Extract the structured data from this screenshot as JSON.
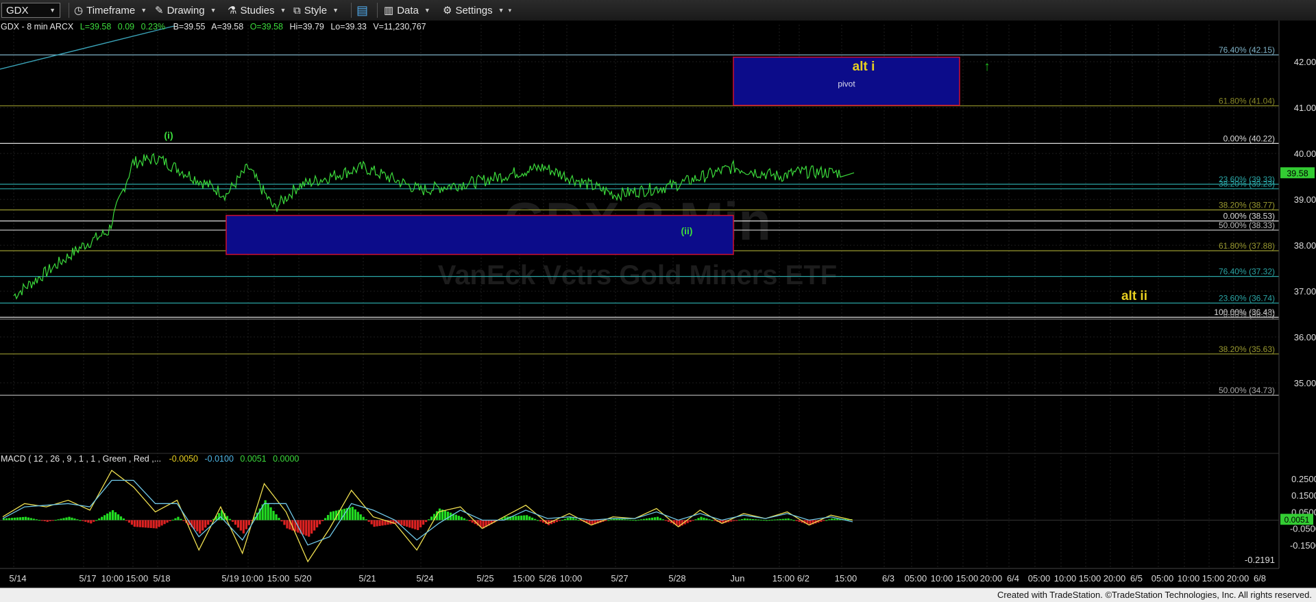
{
  "toolbar": {
    "symbol": "GDX",
    "timeframe": "Timeframe",
    "drawing": "Drawing",
    "studies": "Studies",
    "style": "Style",
    "data": "Data",
    "settings": "Settings"
  },
  "header_quote": {
    "label": "GDX - 8 min  ARCX",
    "last": "L=39.58",
    "change": "0.09",
    "change_pct": "0.23%",
    "bid": "B=39.55",
    "ask": "A=39.58",
    "open": "O=39.58",
    "high": "Hi=39.79",
    "low": "Lo=39.33",
    "volume": "V=11,230,767"
  },
  "watermark": {
    "line1": "GDX 8 Min",
    "line2": "VanEck Vctrs Gold Miners ETF"
  },
  "colors": {
    "price_line": "#3cdc3c",
    "box_fill": "#0c0c8a",
    "box_border": "#d01030",
    "label_yellow": "#e8d020",
    "macd_yellow": "#f0e050",
    "macd_cyan": "#70c8e8"
  },
  "chart_data": [
    {
      "type": "line",
      "series": [
        {
          "name": "GDX - 8 min",
          "x": [
            "5/14",
            "5/17",
            "5/17 10:00",
            "5/17 15:00",
            "5/18",
            "5/19",
            "5/19 10:00",
            "5/19 15:00",
            "5/20",
            "5/21",
            "5/24",
            "5/25",
            "5/25 15:00",
            "5/26",
            "5/26 10:00",
            "5/27",
            "5/28",
            "Jun",
            "Jun 15:00",
            "6/2",
            "6/2 15:00"
          ],
          "values": [
            36.9,
            38.0,
            38.3,
            39.8,
            39.9,
            39.1,
            39.7,
            38.8,
            39.3,
            39.7,
            39.2,
            39.4,
            39.6,
            39.7,
            39.5,
            39.1,
            39.3,
            39.7,
            39.5,
            39.6,
            39.58
          ]
        }
      ],
      "last_price": 39.58,
      "ylim": [
        34.0,
        42.6
      ],
      "y_ticks": [
        "42.00",
        "41.00",
        "40.00",
        "39.00",
        "38.00",
        "37.00",
        "36.00",
        "35.00"
      ],
      "x_ticks": [
        "5/14",
        "5/17",
        "10:00",
        "15:00",
        "5/18",
        "5/19",
        "10:00",
        "15:00",
        "5/20",
        "5/21",
        "5/24",
        "5/25",
        "15:00",
        "5/26",
        "10:00",
        "5/27",
        "5/28",
        "Jun",
        "15:00",
        "6/2",
        "15:00",
        "6/3",
        "05:00",
        "10:00",
        "15:00",
        "20:00",
        "6/4",
        "05:00",
        "10:00",
        "15:00",
        "20:00",
        "6/5",
        "05:00",
        "10:00",
        "15:00",
        "20:00",
        "6/8"
      ],
      "fib_levels": [
        {
          "label": "76.40% (42.15)",
          "value": 42.15,
          "color": "#7fb3c8"
        },
        {
          "label": "61.80% (41.04)",
          "value": 41.04,
          "color": "#8a8a28"
        },
        {
          "label": "0.00% (40.22)",
          "value": 40.22,
          "color": "#dddddd"
        },
        {
          "label": "23.60% (39.33)",
          "value": 39.33,
          "color": "#2aa5a5"
        },
        {
          "label": "38.20% (39.23)",
          "value": 39.23,
          "color": "#2aa5a5"
        },
        {
          "label": "38.20% (38.77)",
          "value": 38.77,
          "color": "#9a9a30"
        },
        {
          "label": "0.00% (38.53)",
          "value": 38.53,
          "color": "#dddddd"
        },
        {
          "label": "50.00% (38.33)",
          "value": 38.33,
          "color": "#bbbbbb"
        },
        {
          "label": "61.80% (37.88)",
          "value": 37.88,
          "color": "#9a9a30"
        },
        {
          "label": "76.40% (37.32)",
          "value": 37.32,
          "color": "#2aa5a5"
        },
        {
          "label": "23.60% (36.74)",
          "value": 36.74,
          "color": "#2aa5a5"
        },
        {
          "label": "100.00% (36.43)",
          "value": 36.43,
          "color": "#dddddd"
        },
        {
          "label": "0.00% (36.39)",
          "value": 36.39,
          "color": "#888888"
        },
        {
          "label": "38.20% (35.63)",
          "value": 35.63,
          "color": "#9a9a30"
        },
        {
          "label": "50.00% (34.73)",
          "value": 34.73,
          "color": "#aaaaaa"
        }
      ],
      "zones": [
        {
          "name": "alt i",
          "sublabel": "pivot",
          "y_top": 42.1,
          "y_bottom": 41.05,
          "x_start": "Jun",
          "x_end": "6/3"
        },
        {
          "name": "",
          "sublabel": "",
          "y_top": 38.65,
          "y_bottom": 37.8,
          "x_start": "5/19",
          "x_end": "Jun"
        }
      ],
      "annotations": [
        {
          "text": "(i)",
          "x": "5/18",
          "y": 40.38,
          "color": "#3cdc3c"
        },
        {
          "text": "(ii)",
          "x": "5/28",
          "y": 38.3,
          "color": "#3cdc3c"
        },
        {
          "text": "alt i",
          "x": "Jun",
          "y": 41.9,
          "color": "#e8d020"
        },
        {
          "text": "alt ii",
          "x": "6/4",
          "y": 36.9,
          "color": "#e8d020"
        },
        {
          "text": "↑",
          "x": "6/3",
          "y": 41.9,
          "color": "#20c020"
        }
      ]
    },
    {
      "type": "line",
      "title": "MACD ( 12 , 26 , 9 , 1 , 1 , Green , Red ,...",
      "readouts": [
        {
          "text": "-0.0050",
          "color": "#e8d020"
        },
        {
          "text": "-0.0100",
          "color": "#4fb8e8"
        },
        {
          "text": "0.0051",
          "color": "#3cdc3c"
        },
        {
          "text": "0.0000",
          "color": "#3cdc3c"
        }
      ],
      "ylim": [
        -0.25,
        0.32
      ],
      "y_ticks": [
        "0.2500",
        "0.1500",
        "0.0500",
        "-0.0500",
        "-0.1500"
      ],
      "current_value": "0.0051",
      "min_label": "-0.2191",
      "series": [
        {
          "name": "MACD",
          "values": [
            0.02,
            0.1,
            0.08,
            0.12,
            0.06,
            0.3,
            0.2,
            0.05,
            0.12,
            -0.18,
            0.08,
            -0.2,
            0.22,
            0.05,
            -0.25,
            -0.05,
            0.18,
            0.02,
            -0.02,
            -0.18,
            0.05,
            0.08,
            -0.05,
            0.02,
            0.09,
            -0.02,
            0.04,
            -0.03,
            0.02,
            0.01,
            0.07,
            -0.04,
            0.06,
            -0.02,
            0.04,
            0.01,
            0.05,
            -0.03,
            0.03,
            0.0
          ]
        },
        {
          "name": "Avg",
          "values": [
            0.01,
            0.08,
            0.09,
            0.1,
            0.08,
            0.24,
            0.24,
            0.1,
            0.1,
            -0.1,
            0.02,
            -0.12,
            0.1,
            0.1,
            -0.15,
            -0.1,
            0.1,
            0.06,
            0.0,
            -0.12,
            -0.02,
            0.06,
            0.0,
            0.0,
            0.06,
            0.01,
            0.02,
            0.0,
            0.01,
            0.01,
            0.05,
            0.0,
            0.04,
            0.0,
            0.03,
            0.01,
            0.04,
            0.0,
            0.02,
            -0.01
          ]
        },
        {
          "name": "Diff",
          "values": [
            0.01,
            0.02,
            -0.01,
            0.02,
            -0.02,
            0.06,
            -0.04,
            -0.05,
            0.02,
            -0.08,
            0.06,
            -0.08,
            0.12,
            -0.05,
            -0.1,
            0.05,
            0.08,
            -0.04,
            -0.02,
            -0.06,
            0.07,
            0.02,
            -0.05,
            0.02,
            0.03,
            -0.03,
            0.02,
            -0.03,
            0.01,
            0.0,
            0.02,
            -0.04,
            0.02,
            -0.02,
            0.01,
            0.0,
            0.01,
            -0.03,
            0.01,
            0.0051
          ]
        }
      ]
    }
  ],
  "footer": "Created with TradeStation. ©TradeStation Technologies, Inc. All rights reserved."
}
